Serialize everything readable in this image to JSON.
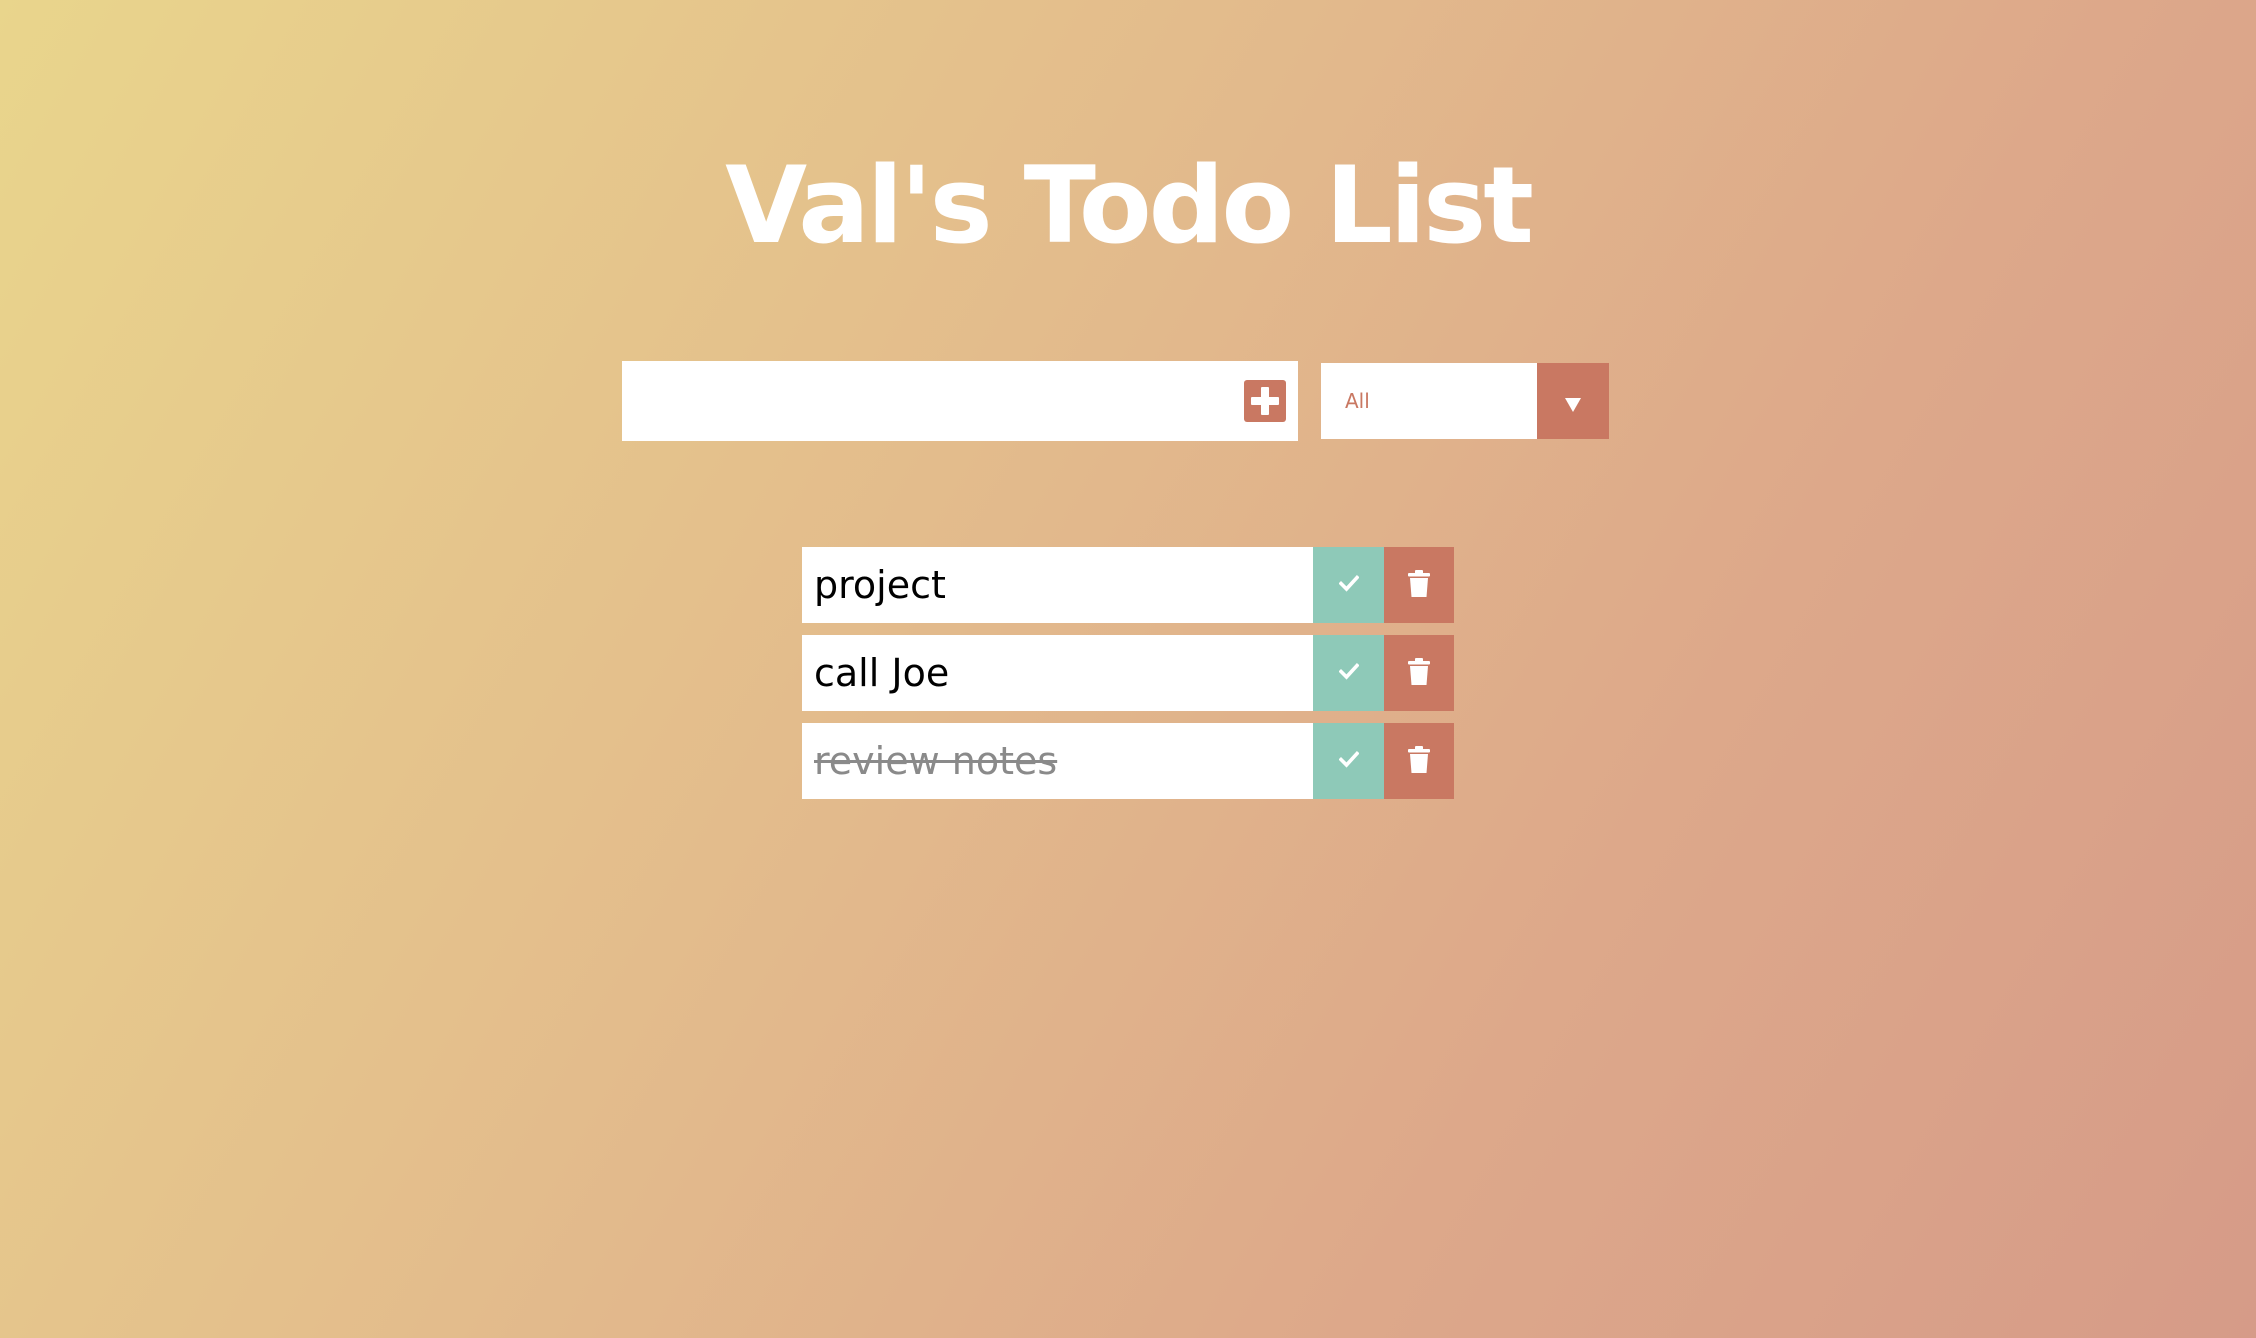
{
  "header": {
    "title": "Val's Todo List"
  },
  "input": {
    "value": "",
    "placeholder": ""
  },
  "filter": {
    "selected": "All",
    "options": [
      "All"
    ]
  },
  "colors": {
    "accent": "#c97862",
    "complete": "#8ec9b8",
    "text": "#000000",
    "completed_text": "#8a8a8a"
  },
  "icons": {
    "add": "plus-square-icon",
    "filter_toggle": "caret-down-icon",
    "complete": "check-icon",
    "delete": "trash-icon"
  },
  "todos": [
    {
      "text": "project",
      "completed": false
    },
    {
      "text": "call Joe",
      "completed": false
    },
    {
      "text": "review notes",
      "completed": true
    }
  ]
}
